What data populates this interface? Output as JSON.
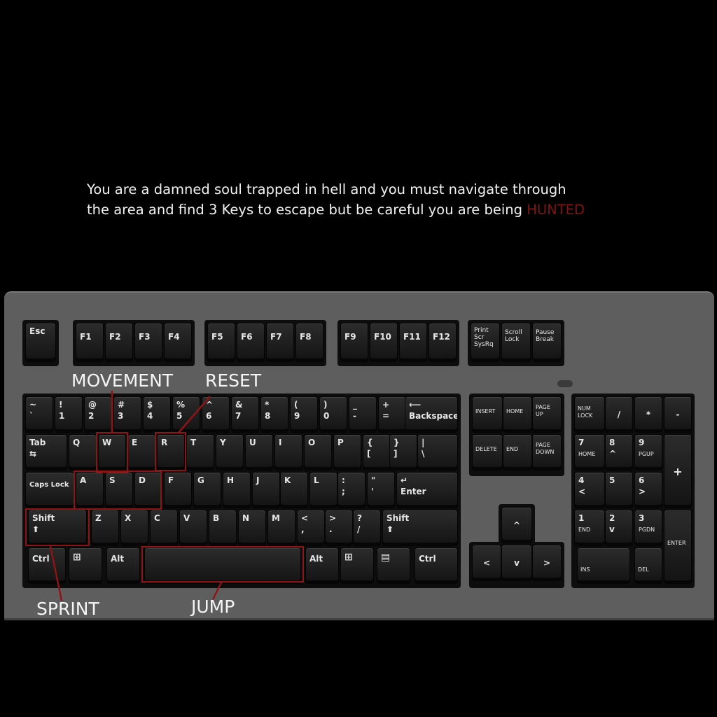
{
  "intro": {
    "line1": "You are a damned soul trapped in hell and you must navigate through",
    "line2": "the area and find 3 Keys to escape but be careful you are being ",
    "hunted": "HUNTED",
    "hunted_color": "#7e1414"
  },
  "labels": {
    "movement": "MOVEMENT",
    "reset": "RESET",
    "sprint": "SPRINT",
    "jump": "JUMP"
  },
  "highlight_color": "#8d1515",
  "keys": {
    "esc": "Esc",
    "f1": "F1",
    "f2": "F2",
    "f3": "F3",
    "f4": "F4",
    "f5": "F5",
    "f6": "F6",
    "f7": "F7",
    "f8": "F8",
    "f9": "F9",
    "f10": "F10",
    "f11": "F11",
    "f12": "F12",
    "prtsc_1": "Print",
    "prtsc_2": "Scr",
    "prtsc_3": "SysRq",
    "scroll_1": "Scroll",
    "scroll_2": "Lock",
    "pause_1": "Pause",
    "pause_2": "Break",
    "tilde_t": "~",
    "tilde_b": "`",
    "n1_t": "!",
    "n1_b": "1",
    "n2_t": "@",
    "n2_b": "2",
    "n3_t": "#",
    "n3_b": "3",
    "n4_t": "$",
    "n4_b": "4",
    "n5_t": "%",
    "n5_b": "5",
    "n6_t": "^",
    "n6_b": "6",
    "n7_t": "&",
    "n7_b": "7",
    "n8_t": "*",
    "n8_b": "8",
    "n9_t": "(",
    "n9_b": "9",
    "n0_t": ")",
    "n0_b": "0",
    "minus_t": "_",
    "minus_b": "-",
    "equal_t": "+",
    "equal_b": "=",
    "backspace_icon": "⟵",
    "backspace": "Backspace",
    "tab": "Tab",
    "tab_icon": "⇆",
    "q": "Q",
    "w": "W",
    "e": "E",
    "r": "R",
    "t": "T",
    "y": "Y",
    "u": "U",
    "i": "I",
    "o": "O",
    "p": "P",
    "lbracket_t": "{",
    "lbracket_b": "[",
    "rbracket_t": "}",
    "rbracket_b": "]",
    "pipe_t": "|",
    "pipe_b": "\\",
    "capslock": "Caps Lock",
    "a": "A",
    "s": "S",
    "d": "D",
    "f": "F",
    "g": "G",
    "h": "H",
    "j": "J",
    "k": "K",
    "l": "L",
    "semicolon_t": ":",
    "semicolon_b": ";",
    "quote_t": "\"",
    "quote_b": "'",
    "enter_icon": "↵",
    "enter": "Enter",
    "shift": "Shift",
    "shift_icon": "⬆",
    "z": "Z",
    "x": "X",
    "c": "C",
    "v": "V",
    "b": "B",
    "n": "N",
    "m": "M",
    "comma_t": "<",
    "comma_b": ",",
    "period_t": ">",
    "period_b": ".",
    "slash_t": "?",
    "slash_b": "/",
    "ctrl": "Ctrl",
    "win": "⊞",
    "alt": "Alt",
    "menu": "▤",
    "insert": "INSERT",
    "home": "HOME",
    "pgup_1": "PAGE",
    "pgup_2": "UP",
    "delete": "DELETE",
    "end": "END",
    "pgdn_1": "PAGE",
    "pgdn_2": "DOWN",
    "up": "^",
    "left": "<",
    "down": "v",
    "right": ">",
    "numlock_1": "NUM",
    "numlock_2": "LOCK",
    "np_div": "/",
    "np_mul": "*",
    "np_sub": "-",
    "np_add": "+",
    "np7": "7",
    "np7_b": "HOME",
    "np8": "8",
    "np8_b": "^",
    "np9": "9",
    "np9_b": "PGUP",
    "np4": "4",
    "np4_b": "<",
    "np5": "5",
    "np6": "6",
    "np6_b": ">",
    "np1": "1",
    "np1_b": "END",
    "np2": "2",
    "np2_b": "v",
    "np3": "3",
    "np3_b": "PGDN",
    "np_enter": "ENTER",
    "np0": "INS",
    "np_dot": "DEL"
  }
}
